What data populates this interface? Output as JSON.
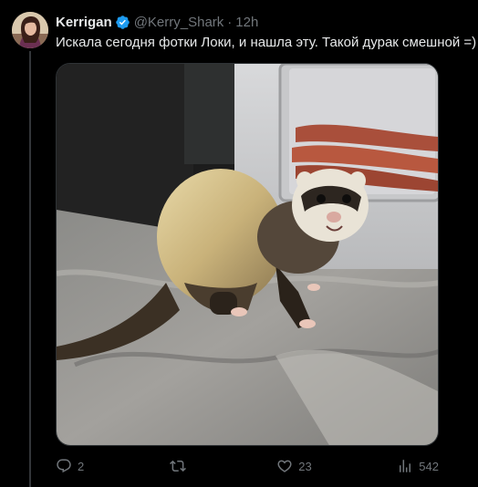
{
  "author": {
    "display_name": "Kerrigan",
    "handle": "@Kerry_Shark",
    "separator": "·",
    "time": "12h",
    "verified": true
  },
  "tweet": {
    "text": "Искала сегодня фотки Локи, и нашла эту. Такой дурак смешной =)"
  },
  "media": {
    "icon": "ferret-photo"
  },
  "actions": {
    "replies": "2",
    "reposts": "",
    "likes": "23",
    "views": "542"
  },
  "colors": {
    "background": "#000000",
    "text_primary": "#e7e9ea",
    "text_secondary": "#71767b",
    "verified_blue": "#1d9bf0",
    "divider": "#333639"
  }
}
